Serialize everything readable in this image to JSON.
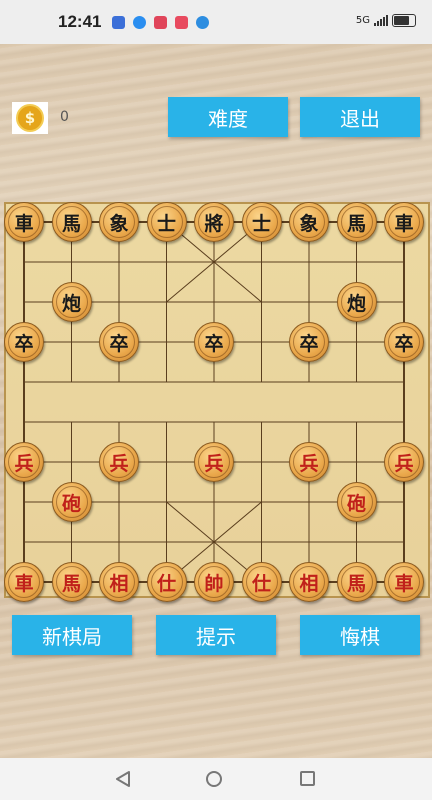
{
  "status_bar": {
    "time": "12:41",
    "network": "5G"
  },
  "coins": {
    "count": "0"
  },
  "top_buttons": {
    "difficulty": "难度",
    "exit": "退出"
  },
  "bottom_buttons": {
    "new_game": "新棋局",
    "hint": "提示",
    "undo": "悔棋"
  },
  "board": {
    "files": 9,
    "ranks": 10,
    "pieces": [
      {
        "text": "車",
        "side": "black",
        "file": 0,
        "rank": 0
      },
      {
        "text": "馬",
        "side": "black",
        "file": 1,
        "rank": 0
      },
      {
        "text": "象",
        "side": "black",
        "file": 2,
        "rank": 0
      },
      {
        "text": "士",
        "side": "black",
        "file": 3,
        "rank": 0
      },
      {
        "text": "將",
        "side": "black",
        "file": 4,
        "rank": 0
      },
      {
        "text": "士",
        "side": "black",
        "file": 5,
        "rank": 0
      },
      {
        "text": "象",
        "side": "black",
        "file": 6,
        "rank": 0
      },
      {
        "text": "馬",
        "side": "black",
        "file": 7,
        "rank": 0
      },
      {
        "text": "車",
        "side": "black",
        "file": 8,
        "rank": 0
      },
      {
        "text": "炮",
        "side": "black",
        "file": 1,
        "rank": 2
      },
      {
        "text": "炮",
        "side": "black",
        "file": 7,
        "rank": 2
      },
      {
        "text": "卒",
        "side": "black",
        "file": 0,
        "rank": 3
      },
      {
        "text": "卒",
        "side": "black",
        "file": 2,
        "rank": 3
      },
      {
        "text": "卒",
        "side": "black",
        "file": 4,
        "rank": 3
      },
      {
        "text": "卒",
        "side": "black",
        "file": 6,
        "rank": 3
      },
      {
        "text": "卒",
        "side": "black",
        "file": 8,
        "rank": 3
      },
      {
        "text": "兵",
        "side": "red",
        "file": 0,
        "rank": 6
      },
      {
        "text": "兵",
        "side": "red",
        "file": 2,
        "rank": 6
      },
      {
        "text": "兵",
        "side": "red",
        "file": 4,
        "rank": 6
      },
      {
        "text": "兵",
        "side": "red",
        "file": 6,
        "rank": 6
      },
      {
        "text": "兵",
        "side": "red",
        "file": 8,
        "rank": 6
      },
      {
        "text": "砲",
        "side": "red",
        "file": 1,
        "rank": 7
      },
      {
        "text": "砲",
        "side": "red",
        "file": 7,
        "rank": 7
      },
      {
        "text": "車",
        "side": "red",
        "file": 0,
        "rank": 9
      },
      {
        "text": "馬",
        "side": "red",
        "file": 1,
        "rank": 9
      },
      {
        "text": "相",
        "side": "red",
        "file": 2,
        "rank": 9
      },
      {
        "text": "仕",
        "side": "red",
        "file": 3,
        "rank": 9
      },
      {
        "text": "帥",
        "side": "red",
        "file": 4,
        "rank": 9
      },
      {
        "text": "仕",
        "side": "red",
        "file": 5,
        "rank": 9
      },
      {
        "text": "相",
        "side": "red",
        "file": 6,
        "rank": 9
      },
      {
        "text": "馬",
        "side": "red",
        "file": 7,
        "rank": 9
      },
      {
        "text": "車",
        "side": "red",
        "file": 8,
        "rank": 9
      }
    ]
  },
  "colors": {
    "button": "#29b3e8",
    "board": "#ecd9a2",
    "red_piece_text": "#c0201a",
    "black_piece_text": "#1a1a1a"
  }
}
